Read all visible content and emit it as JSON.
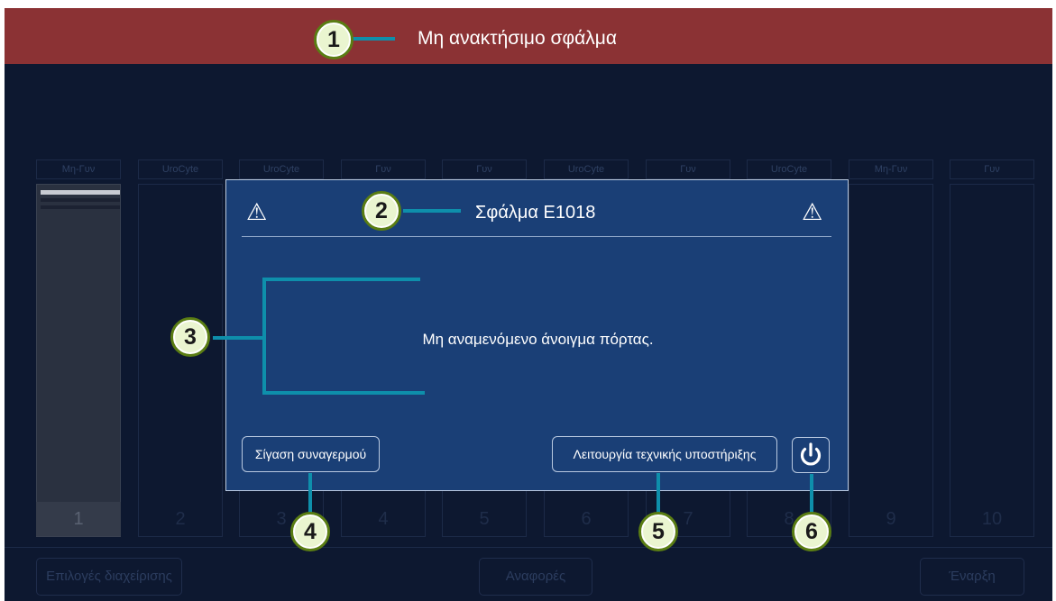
{
  "header": {
    "title": "Μη ανακτήσιμο σφάλμα"
  },
  "columns": [
    {
      "label": "Μη-Γυν",
      "number": "1"
    },
    {
      "label": "UroCyte",
      "number": "2"
    },
    {
      "label": "UroCyte",
      "number": "3"
    },
    {
      "label": "Γυν",
      "number": "4"
    },
    {
      "label": "Γυν",
      "number": "5"
    },
    {
      "label": "UroCyte",
      "number": "6"
    },
    {
      "label": "Γυν",
      "number": "7"
    },
    {
      "label": "UroCyte",
      "number": "8"
    },
    {
      "label": "Μη-Γυν",
      "number": "9"
    },
    {
      "label": "Γυν",
      "number": "10"
    }
  ],
  "footer": {
    "admin_label": "Επιλογές διαχείρισης",
    "reports_label": "Αναφορές",
    "start_label": "Έναρξη"
  },
  "dialog": {
    "title": "Σφάλμα E1018",
    "message": "Μη αναμενόμενο άνοιγμα πόρτας.",
    "silence_label": "Σίγαση συναγερμού",
    "service_label": "Λειτουργία τεχνικής υποστήριξης",
    "warning_glyph": "⚠"
  },
  "callouts": [
    "1",
    "2",
    "3",
    "4",
    "5",
    "6"
  ],
  "colors": {
    "header_bg": "#8b3234",
    "screen_bg": "#0d1830",
    "dialog_bg": "#1a3f76",
    "callout_line": "#0e8fab",
    "badge_ring": "#5a7d13"
  },
  "icons": {
    "warning": "warning-icon",
    "power": "power-icon"
  }
}
